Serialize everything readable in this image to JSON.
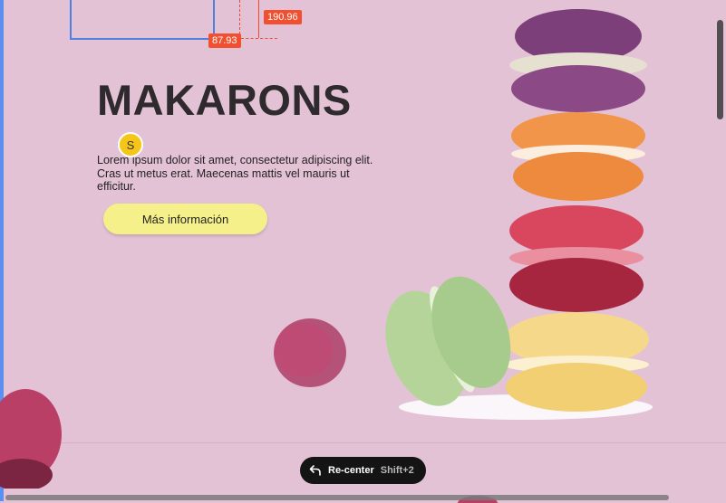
{
  "measurements": {
    "width_label": "190.96",
    "height_label": "87.93"
  },
  "hero": {
    "title": "MAKARONS",
    "description": "Lorem ipsum dolor sit amet, consectetur adipiscing elit. Cras ut metus erat. Maecenas mattis vel mauris ut efficitur.",
    "button_label": "Más información"
  },
  "collaborator": {
    "initial": "S",
    "color": "#f5c518"
  },
  "recenter": {
    "label": "Re-center",
    "shortcut": "Shift+2",
    "icon": "undo-arrow-icon"
  },
  "colors": {
    "background": "#e3c2d5",
    "accent_measure": "#f0502f",
    "selection": "#4f7fe0",
    "button": "#f5f08a"
  }
}
